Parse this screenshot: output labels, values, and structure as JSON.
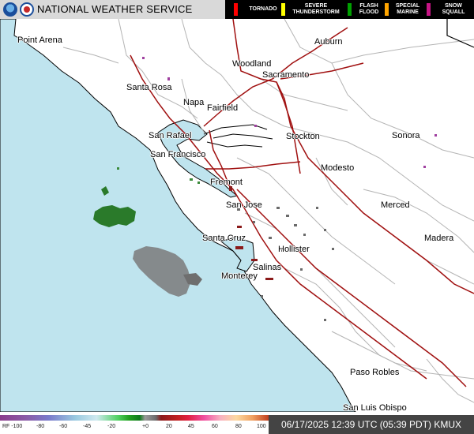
{
  "header": {
    "title": "NATIONAL WEATHER SERVICE",
    "legend": [
      {
        "label": "TORNADO",
        "color": "#ff0000"
      },
      {
        "label": "SEVERE THUNDERSTORM",
        "color": "#ffff00"
      },
      {
        "label": "FLASH FLOOD",
        "color": "#00a000"
      },
      {
        "label": "SPECIAL MARINE",
        "color": "#ffa500"
      },
      {
        "label": "SNOW SQUALL",
        "color": "#c71585"
      }
    ]
  },
  "cities": [
    {
      "name": "Point Arena"
    },
    {
      "name": "Auburn"
    },
    {
      "name": "Woodland"
    },
    {
      "name": "Sacramento"
    },
    {
      "name": "Santa Rosa"
    },
    {
      "name": "Napa"
    },
    {
      "name": "Fairfield"
    },
    {
      "name": "San Rafael"
    },
    {
      "name": "San Francisco"
    },
    {
      "name": "Stockton"
    },
    {
      "name": "Sonora"
    },
    {
      "name": "Modesto"
    },
    {
      "name": "Fremont"
    },
    {
      "name": "San Jose"
    },
    {
      "name": "Merced"
    },
    {
      "name": "Madera"
    },
    {
      "name": "Santa Cruz"
    },
    {
      "name": "Hollister"
    },
    {
      "name": "Salinas"
    },
    {
      "name": "Monterey"
    },
    {
      "name": "Paso Robles"
    },
    {
      "name": "San Luis Obispo"
    }
  ],
  "scale": {
    "ticks": [
      "RF -100",
      "-80",
      "-60",
      "-45",
      "-20",
      "+0",
      "20",
      "45",
      "60",
      "80",
      "100"
    ]
  },
  "timestamp": {
    "text": "06/17/2025 12:39 UTC (05:39 PDT) KMUX"
  },
  "colors": {
    "ocean": "#bfe4ee",
    "land": "#ffffff",
    "highway": "#a01010",
    "county": "#b4b4b4",
    "coast": "#000000"
  }
}
